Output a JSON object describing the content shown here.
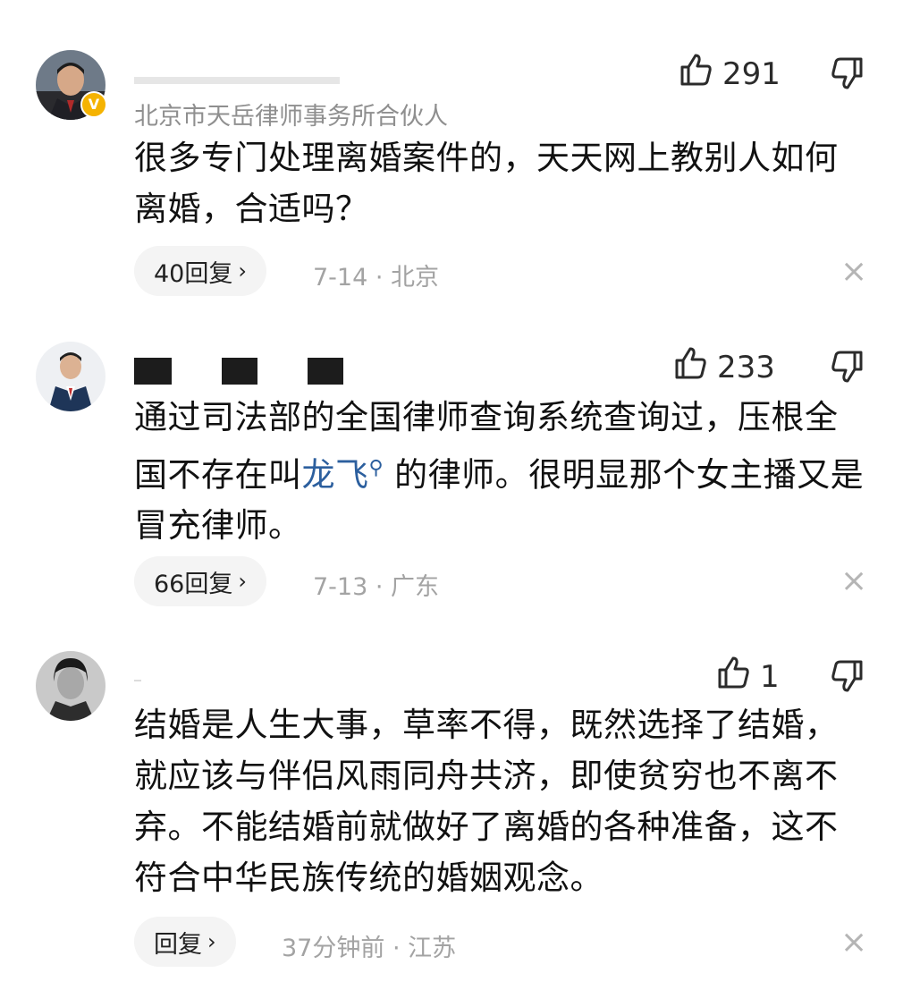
{
  "comments": [
    {
      "user_title": "北京市天岳律师事务所合伙人",
      "likes": "291",
      "text": "很多专门处理离婚案件的，天天网上教别人如何离婚，合适吗？",
      "replies": "40回复",
      "date": "7-14",
      "location": "北京",
      "verified_badge": "V"
    },
    {
      "likes": "233",
      "text_before": "通过司法部的全国律师查询系统查询过，压根全国不存在叫",
      "mention": "龙飞",
      "text_after": "的律师。很明显那个女主播又是冒充律师。",
      "replies": "66回复",
      "date": "7-13",
      "location": "广东"
    },
    {
      "likes": "1",
      "text": "结婚是人生大事，草率不得，既然选择了结婚，就应该与伴侣风雨同舟共济，即使贫穷也不离不弃。不能结婚前就做好了离婚的各种准备，这不符合中华民族传统的婚姻观念。",
      "replies": "回复",
      "date": "37分钟前",
      "location": "江苏"
    }
  ],
  "separator": " · ",
  "icons": {
    "like": "thumbs-up-icon",
    "dislike": "thumbs-down-icon",
    "chevron": "chevron-right-icon",
    "close": "close-icon",
    "search": "search-icon"
  },
  "colors": {
    "mention": "#2c5f9e",
    "verified_badge": "#f5b301",
    "meta_text": "#a3a3a3",
    "pill_bg": "#f4f4f4"
  }
}
